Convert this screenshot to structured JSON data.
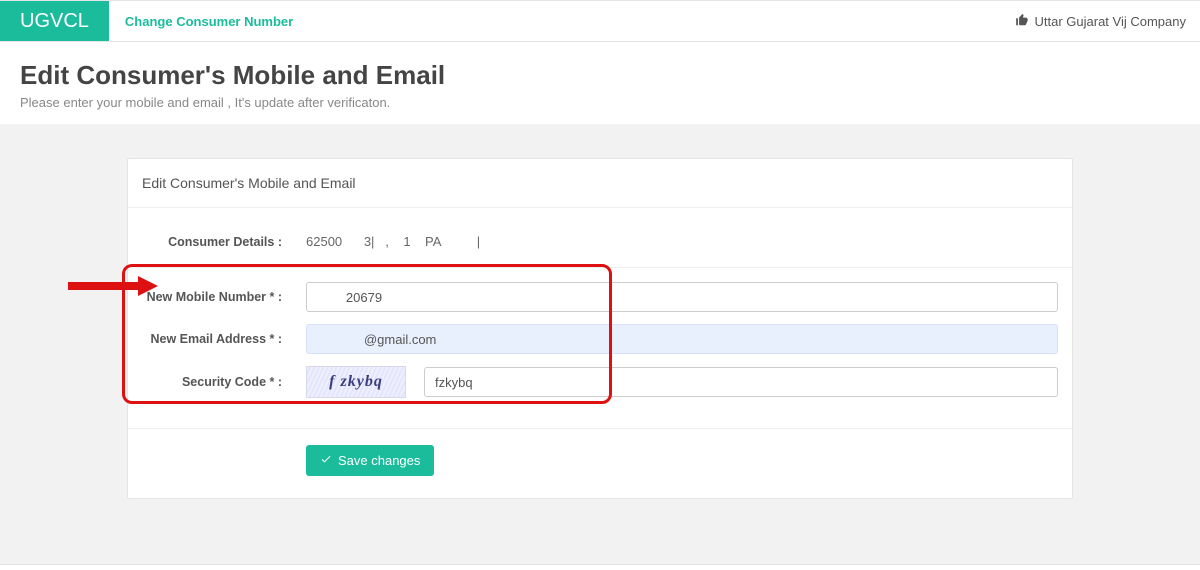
{
  "topbar": {
    "logo": "UGVCL",
    "breadcrumb": "Change Consumer Number",
    "org": "Uttar Gujarat Vij Company"
  },
  "header": {
    "title": "Edit Consumer's Mobile and Email",
    "subtitle": "Please enter your mobile and email , It's update after verificaton."
  },
  "panel": {
    "heading": "Edit Consumer's Mobile and Email",
    "consumer_label": "Consumer Details :",
    "consumer_value": "62500      3|   ,    1    PA          |",
    "mobile_label": "New Mobile Number * :",
    "mobile_value": "        20679",
    "email_label": "New Email Address * :",
    "email_value": "             @gmail.com",
    "code_label": "Security Code * :",
    "captcha_text": "f zkybq",
    "code_value": "fzkybq",
    "save_label": "Save changes"
  }
}
